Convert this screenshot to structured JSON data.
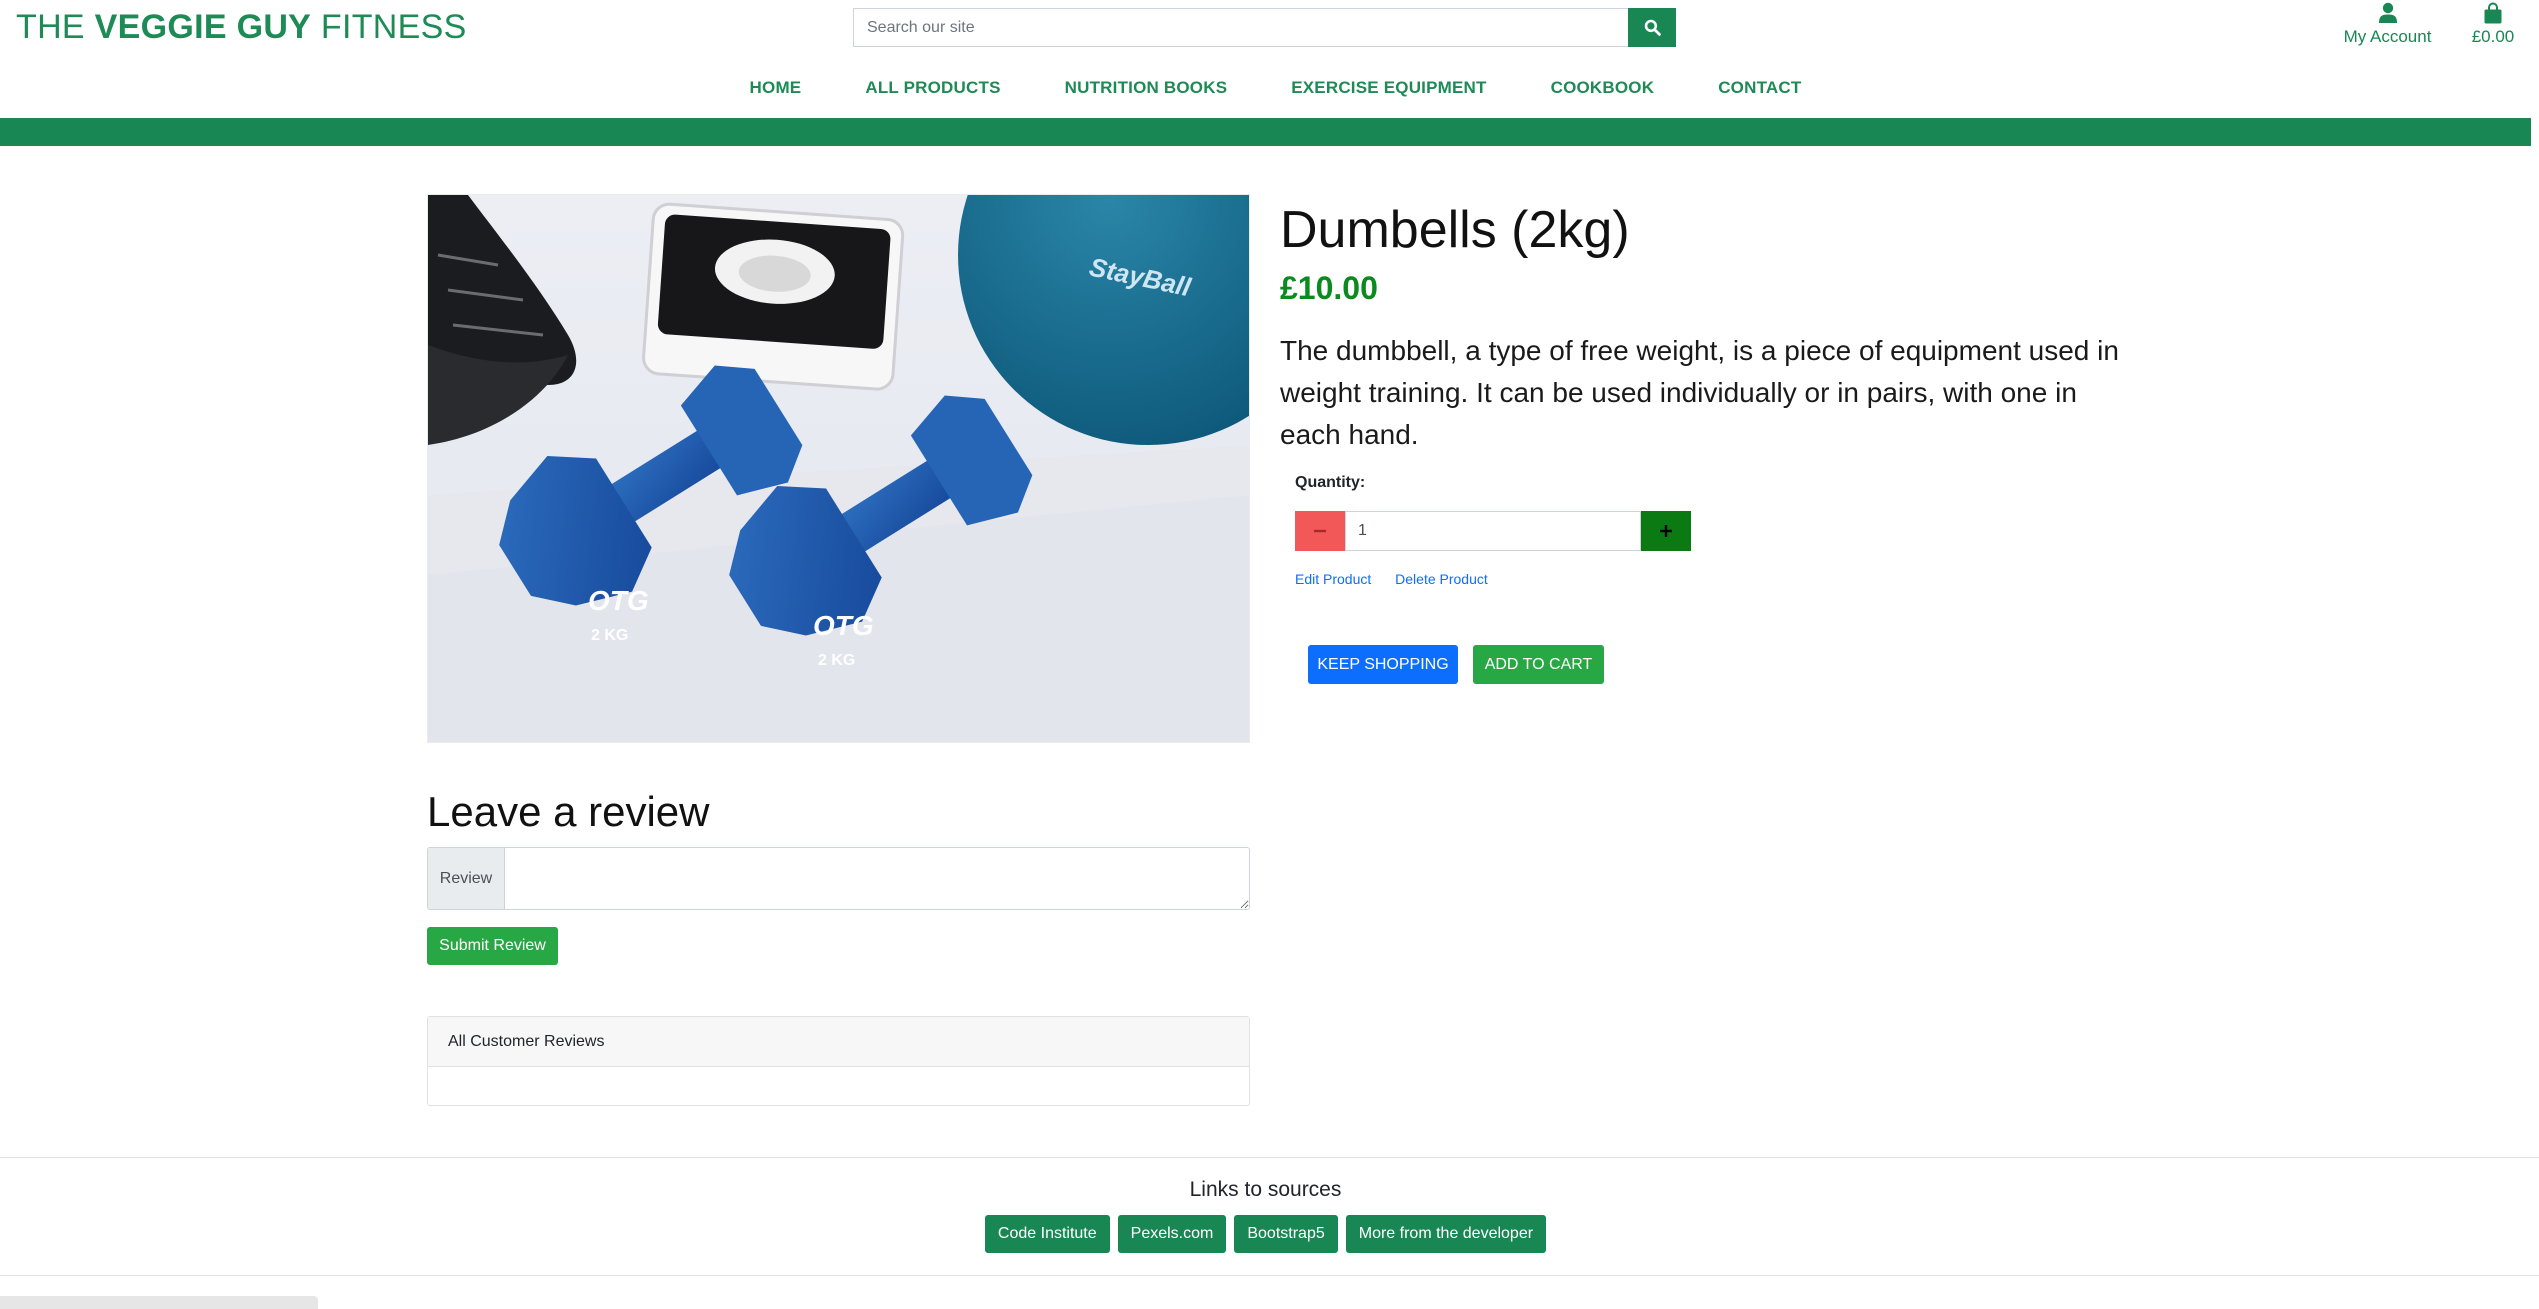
{
  "header": {
    "logo_prefix": "THE ",
    "logo_bold": "VEGGIE GUY",
    "logo_suffix": " FITNESS",
    "search_placeholder": "Search our site",
    "account_label": "My Account",
    "cart_total": "£0.00"
  },
  "nav": {
    "items": [
      "HOME",
      "ALL PRODUCTS",
      "NUTRITION BOOKS",
      "EXERCISE EQUIPMENT",
      "COOKBOOK",
      "CONTACT"
    ]
  },
  "product": {
    "title": "Dumbells (2kg)",
    "price": "£10.00",
    "description": "The dumbbell, a type of free weight, is a piece of equipment used in weight training. It can be used individually or in pairs, with one in each hand.",
    "quantity_label": "Quantity:",
    "quantity_value": "1",
    "edit_label": "Edit Product",
    "delete_label": "Delete Product",
    "keep_shopping": "KEEP SHOPPING",
    "add_to_cart": "ADD TO CART",
    "image": {
      "ball_text": "StayBall",
      "weight_text": "2 KG",
      "brand_text": "OTG"
    }
  },
  "review": {
    "heading": "Leave a review",
    "field_label": "Review",
    "submit_label": "Submit Review",
    "list_heading": "All Customer Reviews"
  },
  "footer": {
    "title": "Links to sources",
    "links": [
      "Code Institute",
      "Pexels.com",
      "Bootstrap5",
      "More from the developer"
    ]
  },
  "colors": {
    "brand_green": "#198754",
    "price_green": "#0b8a1f",
    "primary_blue": "#0d6efd",
    "success_green": "#28a745",
    "minus_red": "#f35858"
  }
}
